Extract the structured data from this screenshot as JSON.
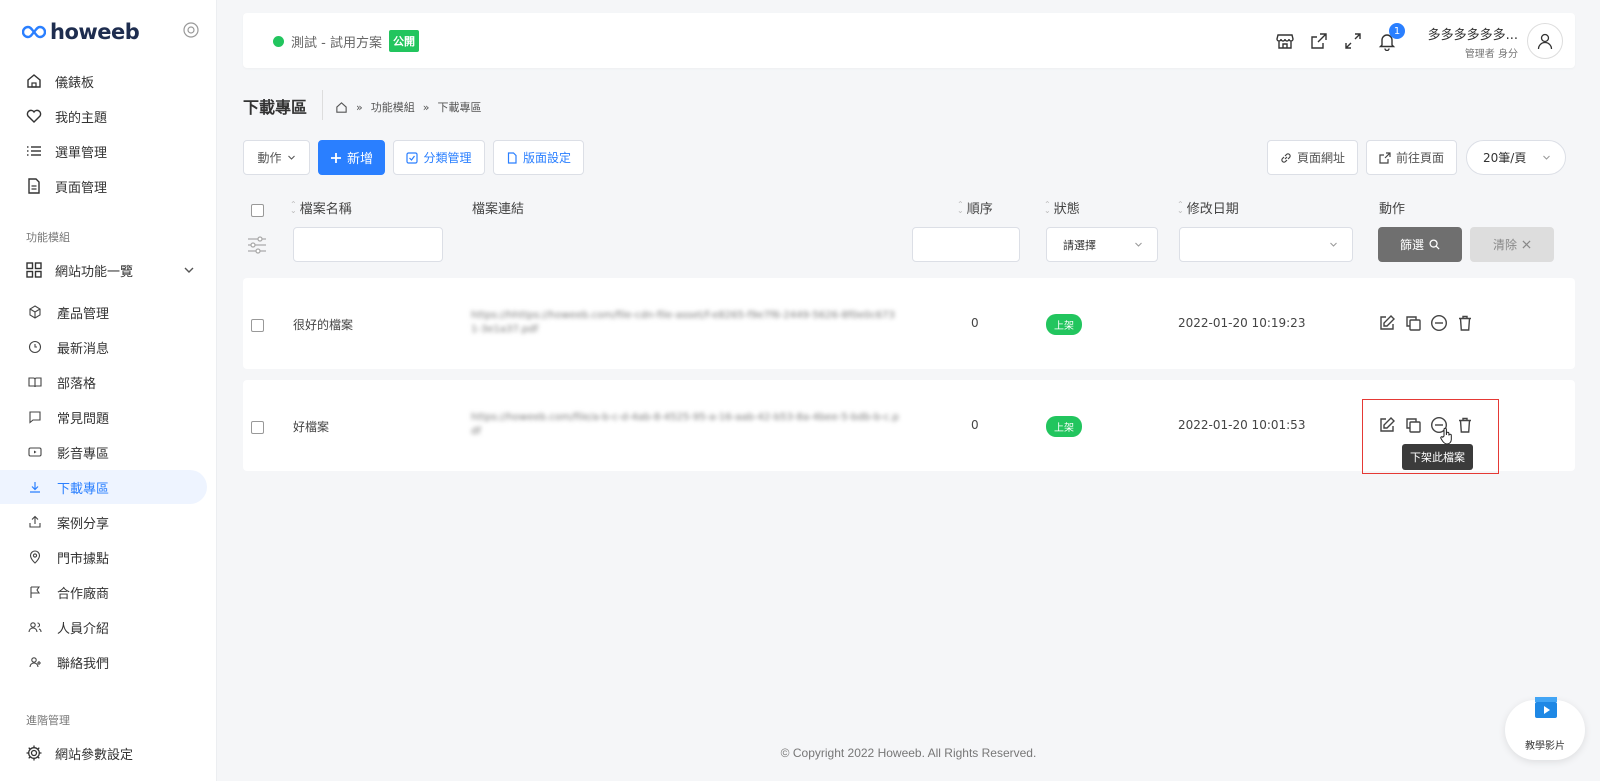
{
  "app": {
    "logo_text": "howeeb"
  },
  "sidebar": {
    "items": [
      {
        "label": "儀錶板",
        "icon": "home-icon"
      },
      {
        "label": "我的主題",
        "icon": "heart-icon"
      },
      {
        "label": "選單管理",
        "icon": "list-icon"
      },
      {
        "label": "頁面管理",
        "icon": "document-icon"
      }
    ],
    "section_modules": "功能模組",
    "modules_group": "網站功能一覽",
    "module_items": [
      {
        "label": "產品管理",
        "icon": "box-icon"
      },
      {
        "label": "最新消息",
        "icon": "clock-icon"
      },
      {
        "label": "部落格",
        "icon": "book-icon"
      },
      {
        "label": "常見問題",
        "icon": "chat-icon"
      },
      {
        "label": "影音專區",
        "icon": "video-icon"
      },
      {
        "label": "下載專區",
        "icon": "download-icon",
        "active": true
      },
      {
        "label": "案例分享",
        "icon": "share-icon"
      },
      {
        "label": "門市據點",
        "icon": "location-icon"
      },
      {
        "label": "合作廠商",
        "icon": "flag-icon"
      },
      {
        "label": "人員介紹",
        "icon": "users-icon"
      },
      {
        "label": "聯絡我們",
        "icon": "contact-icon"
      }
    ],
    "section_advanced": "進階管理",
    "advanced_items": [
      {
        "label": "網站參數設定",
        "icon": "gear-icon"
      }
    ]
  },
  "topbar": {
    "site_name": "測試 - 試用方案",
    "public_badge": "公開",
    "notification_count": "1",
    "user_name": "多多多多多多...",
    "user_role": "管理者 身分"
  },
  "page": {
    "title": "下載專區",
    "breadcrumb": [
      "功能模組",
      "下載專區"
    ]
  },
  "toolbar": {
    "action_label": "動作",
    "add_label": "新增",
    "category_label": "分類管理",
    "layout_label": "版面設定",
    "page_url_label": "頁面網址",
    "goto_page_label": "前往頁面",
    "per_page": "20筆/頁"
  },
  "table": {
    "headers": {
      "file_name": "檔案名稱",
      "file_link": "檔案連結",
      "order": "順序",
      "status": "狀態",
      "modified": "修改日期",
      "actions": "動作"
    },
    "filter": {
      "status_placeholder": "請選擇",
      "filter_btn": "篩選",
      "clear_btn": "清除"
    },
    "rows": [
      {
        "name": "很好的檔案",
        "link": "https://hhttps://howeeb.com/file-cdn-file-asset/f-e8265-f9e7f6-2449-5626-8f0e0c6731-3e1a37.pdf",
        "order": "0",
        "status": "上架",
        "modified": "2022-01-20 10:19:23"
      },
      {
        "name": "好檔案",
        "link": "https://howeeb.com/file/a-b-c-d-4ab-8-4525-95-a-16-aab-42-b53-8a-4bee-5-bdb-b-c.pdf",
        "order": "0",
        "status": "上架",
        "modified": "2022-01-20 10:01:53"
      }
    ],
    "tooltip": "下架此檔案"
  },
  "footer": {
    "copyright": "© Copyright 2022 Howeeb. All Rights Reserved."
  },
  "tutorial": {
    "label": "教學影片"
  },
  "colors": {
    "accent": "#2a7fff",
    "success": "#22c55e",
    "highlight": "#e53935"
  }
}
